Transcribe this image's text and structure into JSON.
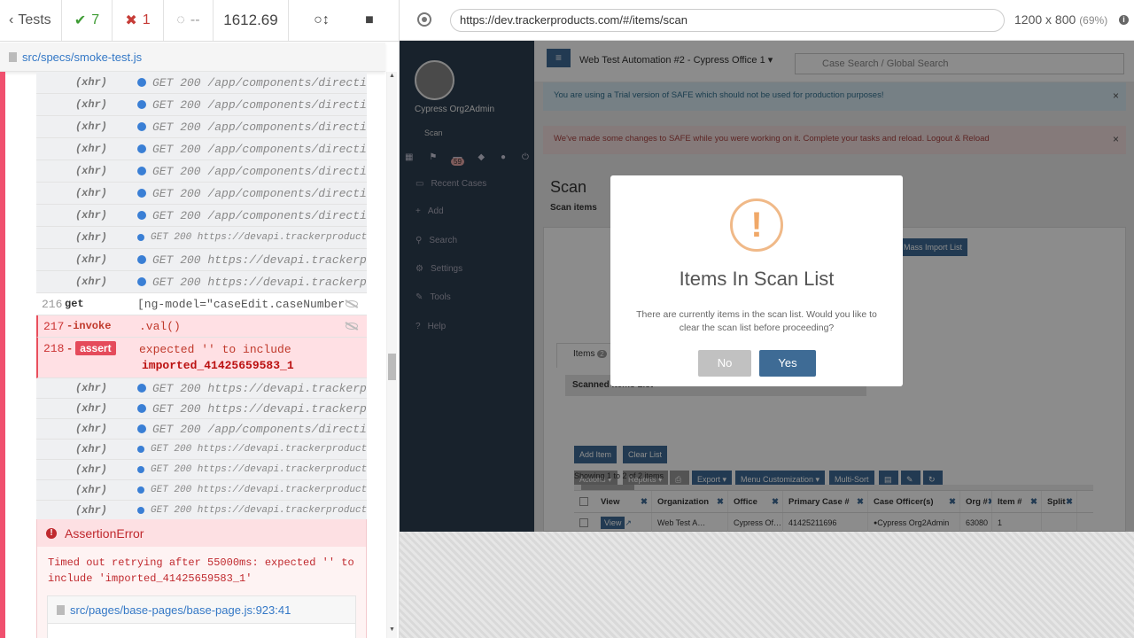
{
  "reporter": {
    "tests_label": "Tests",
    "passed": "7",
    "failed": "1",
    "pending": "--",
    "duration": "1612.69"
  },
  "spec_file": "src/specs/smoke-test.js",
  "commands": [
    {
      "num": "",
      "name": "(xhr)",
      "msg": "GET 200 /app/components/directi…",
      "small": false
    },
    {
      "num": "",
      "name": "(xhr)",
      "msg": "GET 200 /app/components/directi…",
      "small": false
    },
    {
      "num": "",
      "name": "(xhr)",
      "msg": "GET 200 /app/components/directi…",
      "small": false
    },
    {
      "num": "",
      "name": "(xhr)",
      "msg": "GET 200 /app/components/directi…",
      "small": false
    },
    {
      "num": "",
      "name": "(xhr)",
      "msg": "GET 200 /app/components/directi…",
      "small": false
    },
    {
      "num": "",
      "name": "(xhr)",
      "msg": "GET 200 /app/components/directi…",
      "small": false
    },
    {
      "num": "",
      "name": "(xhr)",
      "msg": "GET 200 /app/components/directi…",
      "small": false
    },
    {
      "num": "",
      "name": "(xhr)",
      "msg": "GET 200 https://devapi.trackerproducts…",
      "small": true
    },
    {
      "num": "",
      "name": "(xhr)",
      "msg": "GET 200 https://devapi.trackerp…",
      "small": false
    },
    {
      "num": "",
      "name": "(xhr)",
      "msg": "GET 200 https://devapi.trackerp…",
      "small": false
    }
  ],
  "cmd_get": {
    "num": "216",
    "name": "get",
    "msg": "[ng-model=\"caseEdit.caseNumber\"]"
  },
  "cmd_invoke": {
    "num": "217",
    "name": "-invoke",
    "msg": ".val()"
  },
  "cmd_assert": {
    "num": "218",
    "dash": "-",
    "name": "assert",
    "msg1": "expected '' to include",
    "msg2": "imported_41425659583_1"
  },
  "commands2": [
    {
      "name": "(xhr)",
      "msg": "GET 200 https://devapi.trackerp…",
      "small": false
    },
    {
      "name": "(xhr)",
      "msg": "GET 200 https://devapi.trackerp…",
      "small": false
    },
    {
      "name": "(xhr)",
      "msg": "GET 200 /app/components/directi…",
      "small": false
    },
    {
      "name": "(xhr)",
      "msg": "GET 200 https://devapi.trackerproducts…",
      "small": true
    },
    {
      "name": "(xhr)",
      "msg": "GET 200 https://devapi.trackerproducts…",
      "small": true
    },
    {
      "name": "(xhr)",
      "msg": "GET 200 https://devapi.trackerproducts…",
      "small": true
    },
    {
      "name": "(xhr)",
      "msg": "GET 200 https://devapi.trackerproducts…",
      "small": true
    }
  ],
  "error": {
    "title": "AssertionError",
    "message": "Timed out retrying after 55000ms: expected '' to include 'imported_41425659583_1'",
    "file": "src/pages/base-pages/base-page.js:923:41"
  },
  "aut": {
    "url": "https://dev.trackerproducts.com/#/items/scan",
    "viewport": "1200 x 800",
    "zoom": "(69%)",
    "user": "Cypress Org2Admin",
    "user_sub": "Scan",
    "badge": "59",
    "nav": [
      {
        "icon": "▭",
        "label": "Recent Cases"
      },
      {
        "icon": "+",
        "label": "Add"
      },
      {
        "icon": "⚲",
        "label": "Search"
      },
      {
        "icon": "⚙",
        "label": "Settings"
      },
      {
        "icon": "✎",
        "label": "Tools"
      },
      {
        "icon": "?",
        "label": "Help"
      }
    ],
    "org_selector": "Web Test Automation #2 - Cypress Office 1",
    "search_placeholder": "Case Search / Global Search",
    "alert_trial": "You are using a Trial version of SAFE which should not be used for production purposes!",
    "alert_changes": "We've made some changes to SAFE while you were working on it. Complete your tasks and reload.   Logout & Reload",
    "page_title": "Scan",
    "page_subtitle": "Scan items",
    "mass_import": "Mass Import List",
    "items_tab": "Items",
    "items_count": "2",
    "scanned_label": "Scanned Items List",
    "add_item": "Add Item",
    "clear_list": "Clear List",
    "actions": "Actions ▾",
    "reports": "Reports ▾",
    "export": "Export ▾",
    "menu_custom": "Menu Customization ▾",
    "multisort": "Multi-Sort",
    "showing": "Showing 1 to 2 of 2 items",
    "columns": [
      "View",
      "Organization",
      "Office",
      "Primary Case #",
      "Case Officer(s)",
      "Org #",
      "Item #",
      "Split"
    ],
    "row": [
      "View",
      "Web Test A…",
      "Cypress Of…",
      "41425211696",
      "Cypress Org2Admin",
      "63080",
      "1",
      ""
    ]
  },
  "modal": {
    "title": "Items In Scan List",
    "text": "There are currently items in the scan list. Would you like to clear the scan list before proceeding?",
    "no": "No",
    "yes": "Yes"
  }
}
